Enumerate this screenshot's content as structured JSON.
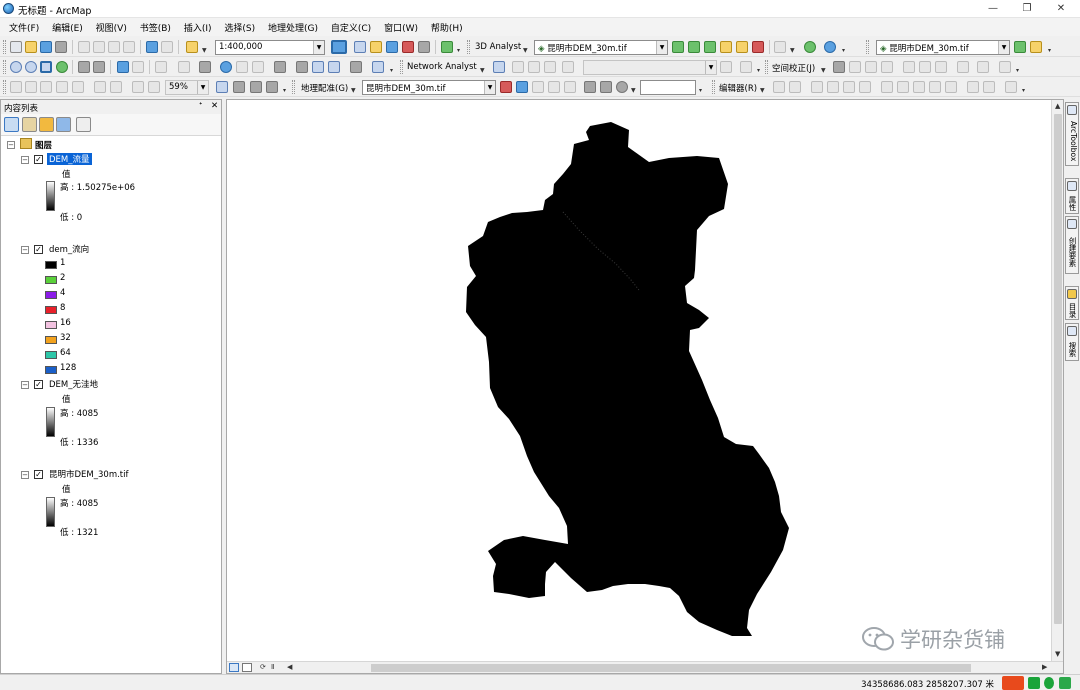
{
  "window": {
    "title": "无标题 - ArcMap",
    "min": "—",
    "restore": "❐",
    "close": "✕"
  },
  "menubar": [
    "文件(F)",
    "编辑(E)",
    "视图(V)",
    "书签(B)",
    "插入(I)",
    "选择(S)",
    "地理处理(G)",
    "自定义(C)",
    "窗口(W)",
    "帮助(H)"
  ],
  "toolbar1": {
    "scale": "1:400,000",
    "analyst3d": "3D Analyst",
    "layer_combo": "昆明市DEM_30m.tif",
    "layer_combo_right": "昆明市DEM_30m.tif"
  },
  "toolbar2": {
    "zoom_pct": "59%",
    "network_analyst": "Network Analyst",
    "spatial_adjust": "空间校正(J)"
  },
  "toolbar3": {
    "georef": "地理配准(G)",
    "georef_layer": "昆明市DEM_30m.tif",
    "editor": "编辑器(R)"
  },
  "toc": {
    "title": "内容列表",
    "pin": "ᐩ",
    "close": "✕",
    "layers_group": "图层",
    "layers": [
      {
        "name": "DEM_流量",
        "field": "值",
        "high": "高 : 1.50275e+06",
        "low": "低 : 0"
      },
      {
        "name": "dem_流向",
        "classes": [
          "1",
          "2",
          "4",
          "8",
          "16",
          "32",
          "64",
          "128"
        ]
      },
      {
        "name": "DEM_无洼地",
        "field": "值",
        "high": "高 : 4085",
        "low": "低 : 1336"
      },
      {
        "name": "昆明市DEM_30m.tif",
        "field": "值",
        "high": "高 : 4085",
        "low": "低 : 1321"
      }
    ]
  },
  "flow_colors": [
    "#000000",
    "#5ad03a",
    "#8b1ce8",
    "#e8202a",
    "#f2c2e0",
    "#f2a21e",
    "#2ec6a8",
    "#1a5fc8"
  ],
  "right_dock": [
    "ArcToolbox",
    "属性",
    "创建要素",
    "目录",
    "搜索"
  ],
  "status": {
    "coords": "34358686.083  2858207.307 米"
  },
  "watermark": "学研杂货铺"
}
